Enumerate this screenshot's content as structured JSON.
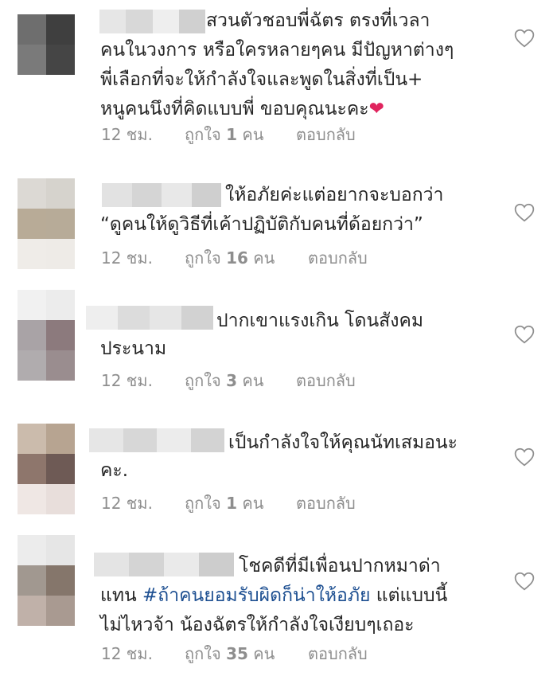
{
  "comments": [
    {
      "lines": [
        "สวนตัวชอบพี่ฉัตร ตรงที่เวลา",
        "คนในวงการ หรือใครหลายๆคน มีปัญหาต่างๆ",
        "พี่เลือกที่จะให้กำลังใจและพูดในสิ่งที่เป็น+",
        "หนูคนนึงที่คิดแบบพี่ ขอบคุณนะคะ"
      ],
      "emoji": "❤",
      "time": "12 ชม.",
      "likes_prefix": "ถูกใจ",
      "likes_count": "1",
      "likes_suffix": "คน",
      "reply": "ตอบกลับ"
    },
    {
      "lines": [
        "ให้อภัยค่ะแต่อยากจะบอกว่า",
        "“ดูคนให้ดูวิธีที่เค้าปฏิบัติกับคนที่ด้อยกว่า”"
      ],
      "time": "12 ชม.",
      "likes_prefix": "ถูกใจ",
      "likes_count": "16",
      "likes_suffix": "คน",
      "reply": "ตอบกลับ"
    },
    {
      "lines": [
        "ปากเขาแรงเกิน โดนสังคม",
        "ประนาม"
      ],
      "time": "12 ชม.",
      "likes_prefix": "ถูกใจ",
      "likes_count": "3",
      "likes_suffix": "คน",
      "reply": "ตอบกลับ"
    },
    {
      "lines": [
        "เป็นกำลังใจให้คุณนัทเสมอนะ",
        "คะ."
      ],
      "time": "12 ชม.",
      "likes_prefix": "ถูกใจ",
      "likes_count": "1",
      "likes_suffix": "คน",
      "reply": "ตอบกลับ"
    },
    {
      "lines": [
        "โชคดีที่มีเพื่อนปากหมาด่า",
        "แทน",
        "แต่แบบนี้",
        "ไม่ไหวจ้า น้องฉัตรให้กำลังใจเงียบๆเถอะ"
      ],
      "hashtag": "#ถ้าคนยอมรับผิดก็น่าให้อภัย",
      "time": "12 ชม.",
      "likes_prefix": "ถูกใจ",
      "likes_count": "35",
      "likes_suffix": "คน",
      "reply": "ตอบกลับ"
    }
  ],
  "icons": {
    "like": "heart-outline-icon",
    "emoji": "red-heart-emoji"
  },
  "colors": {
    "text": "#262626",
    "meta": "#8e8e8e",
    "hashtag": "#1d4f91",
    "heart": "#e0245e"
  }
}
